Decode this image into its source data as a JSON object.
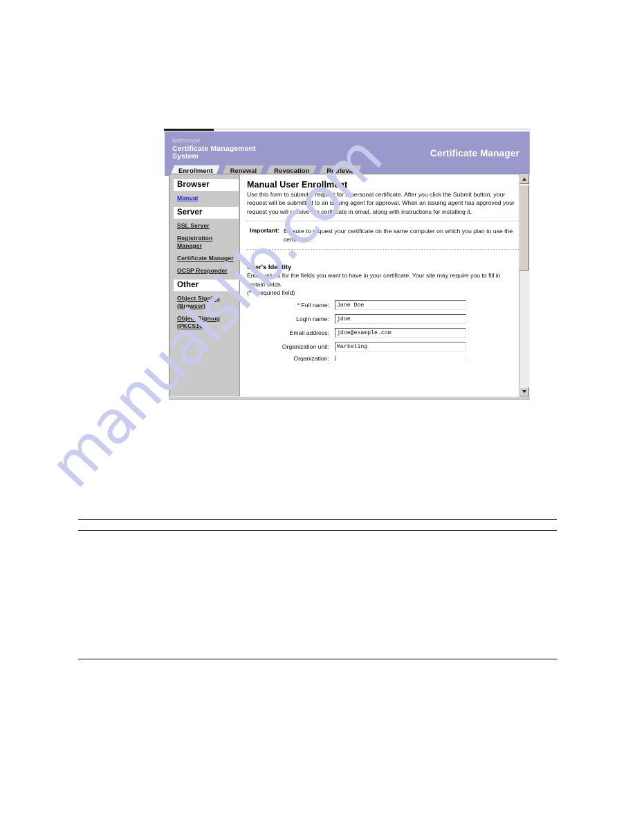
{
  "watermark": {
    "text": "manualslib.com"
  },
  "banner": {
    "brand_netscape": "Netscape",
    "brand_line1": "Certificate Management",
    "brand_line2": "System",
    "product_title": "Certificate Manager"
  },
  "tabs": [
    {
      "label": "Enrollment",
      "active": true
    },
    {
      "label": "Renewal",
      "active": false
    },
    {
      "label": "Revocation",
      "active": false
    },
    {
      "label": "Retrieval",
      "active": false
    }
  ],
  "sidebar": {
    "items": [
      {
        "label": "Browser",
        "type": "heading"
      },
      {
        "label": "Manual",
        "type": "link",
        "current": true
      },
      {
        "label": "Server",
        "type": "heading"
      },
      {
        "label": "SSL Server",
        "type": "link",
        "current": false
      },
      {
        "label": "Registration Manager",
        "type": "link",
        "current": false
      },
      {
        "label": "Certificate Manager",
        "type": "link",
        "current": false
      },
      {
        "label": "OCSP Responder",
        "type": "link",
        "current": false
      },
      {
        "label": "Other",
        "type": "heading"
      },
      {
        "label": "Object Signing (Browser)",
        "type": "link",
        "current": false
      },
      {
        "label": "Object Signing (PKCS10)",
        "type": "link",
        "current": false
      }
    ]
  },
  "main": {
    "page_title": "Manual User Enrollment",
    "intro": "Use this form to submit a request for a personal certificate. After you click the Submit button, your request will be submitted to an issuing agent for approval. When an issuing agent has approved your request you will receive the certificate in email, along with instructions for installing it.",
    "important_label": "Important:",
    "important_text": "Be sure to request your certificate on the same computer on which you plan to use the certificate.",
    "section_title": "User's Identity",
    "section_desc": "Enter values for the fields you want to have in your certificate. Your site may require you to fill in certain fields.",
    "required_note": "(* = required field)",
    "fields": [
      {
        "label": "* Full name:",
        "value": "Jane Doe"
      },
      {
        "label": "Login name:",
        "value": "jdoe"
      },
      {
        "label": "Email address:",
        "value": "jdoe@example.com"
      },
      {
        "label": "Organization unit:",
        "value": "Marketing"
      },
      {
        "label": "Organization:",
        "value": ""
      }
    ]
  },
  "scrollbar": {
    "up_arrow": "scroll-up-arrow",
    "down_arrow": "scroll-down-arrow"
  },
  "colors": {
    "banner_purple": "#9999cc",
    "sidebar_gray": "#c9c9c9",
    "tab_inactive": "#c4c4c4",
    "tab_active": "#f2f2f2",
    "link_current": "#2222dd",
    "watermark": "#c9cbee"
  }
}
